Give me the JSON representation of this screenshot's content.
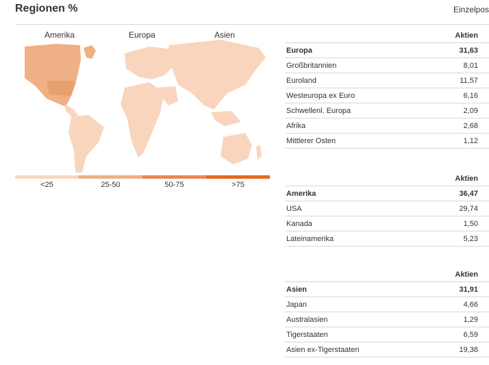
{
  "page": {
    "title": "Regionen %",
    "link": "Einzelpos"
  },
  "map": {
    "labels": {
      "americas": "Amerika",
      "europe": "Europa",
      "asia": "Asien"
    },
    "colors": {
      "americas": "#EFB085",
      "europe": "#F9D5BE",
      "asia": "#F9D5BE",
      "highlight": "#E9A06F"
    }
  },
  "legend": {
    "items": [
      {
        "label": "<25",
        "color": "#F9D5BE"
      },
      {
        "label": "25-50",
        "color": "#EFB085"
      },
      {
        "label": "50-75",
        "color": "#E98755"
      },
      {
        "label": ">75",
        "color": "#E36A1C"
      }
    ]
  },
  "tables": {
    "europa": {
      "column": "Aktien",
      "total": {
        "name": "Europa",
        "value": "31,63"
      },
      "rows": [
        {
          "name": "Großbritannien",
          "value": "8,01"
        },
        {
          "name": "Euroland",
          "value": "11,57"
        },
        {
          "name": "Westeuropa ex Euro",
          "value": "6,16"
        },
        {
          "name": "Schwellenl. Europa",
          "value": "2,09"
        },
        {
          "name": "Afrika",
          "value": "2,68"
        },
        {
          "name": "Mittlerer Osten",
          "value": "1,12"
        }
      ]
    },
    "amerika": {
      "column": "Aktien",
      "total": {
        "name": "Amerika",
        "value": "36,47"
      },
      "rows": [
        {
          "name": "USA",
          "value": "29,74"
        },
        {
          "name": "Kanada",
          "value": "1,50"
        },
        {
          "name": "Lateinamerika",
          "value": "5,23"
        }
      ]
    },
    "asien": {
      "column": "Aktien",
      "total": {
        "name": "Asien",
        "value": "31,91"
      },
      "rows": [
        {
          "name": "Japan",
          "value": "4,66"
        },
        {
          "name": "Australasien",
          "value": "1,29"
        },
        {
          "name": "Tigerstaaten",
          "value": "6,59"
        },
        {
          "name": "Asien ex-Tigerstaaten",
          "value": "19,38"
        }
      ]
    }
  }
}
